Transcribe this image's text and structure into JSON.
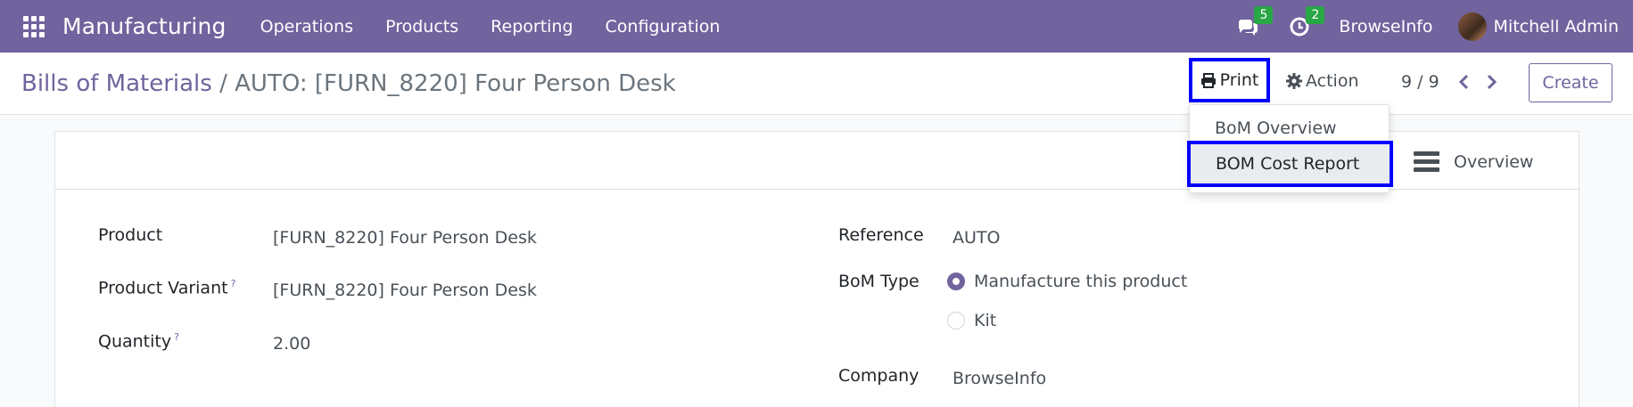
{
  "navbar": {
    "app_name": "Manufacturing",
    "menu": [
      "Operations",
      "Products",
      "Reporting",
      "Configuration"
    ],
    "messages_count": "5",
    "activities_count": "2",
    "company": "BrowseInfo",
    "user": "Mitchell Admin",
    "color": "#71639e"
  },
  "control": {
    "breadcrumb_parent": "Bills of Materials",
    "breadcrumb_sep": " / ",
    "breadcrumb_current": "AUTO: [FURN_8220] Four Person Desk",
    "print_label": "Print",
    "action_label": "Action",
    "pager": "9 / 9",
    "create_label": "Create"
  },
  "print_menu": {
    "items": [
      "BoM Overview",
      "BOM Cost Report"
    ]
  },
  "button_box": {
    "overview_label": "Overview"
  },
  "form": {
    "product_label": "Product",
    "product_value": "[FURN_8220] Four Person Desk",
    "variant_label": "Product Variant",
    "variant_value": "[FURN_8220] Four Person Desk",
    "quantity_label": "Quantity",
    "quantity_value": "2.00",
    "help_mark": "?",
    "reference_label": "Reference",
    "reference_value": "AUTO",
    "bom_type_label": "BoM Type",
    "bom_type_options": [
      "Manufacture this product",
      "Kit"
    ],
    "bom_type_selected": "Manufacture this product",
    "company_label": "Company",
    "company_value": "BrowseInfo"
  },
  "highlight_color": "#0000ff"
}
